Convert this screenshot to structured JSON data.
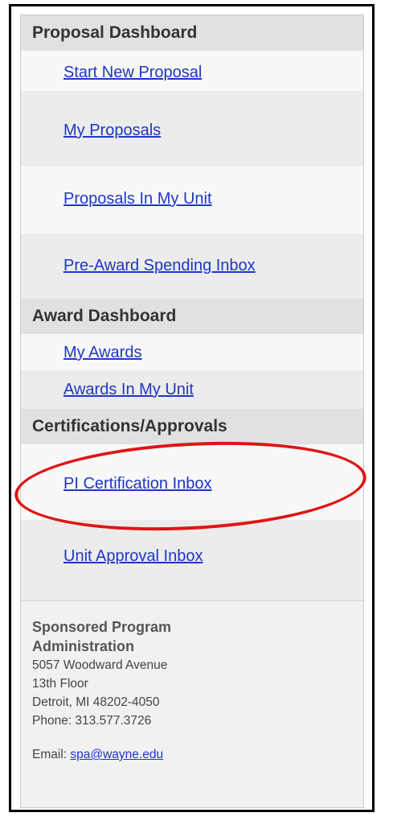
{
  "proposal_dashboard": {
    "heading": "Proposal Dashboard",
    "items": [
      {
        "label": "Start New Proposal"
      },
      {
        "label": "My Proposals"
      },
      {
        "label": "Proposals In My Unit"
      },
      {
        "label": "Pre-Award Spending Inbox"
      }
    ]
  },
  "award_dashboard": {
    "heading": "Award Dashboard",
    "items": [
      {
        "label": "My Awards"
      },
      {
        "label": "Awards In My Unit"
      }
    ]
  },
  "certifications": {
    "heading": "Certifications/Approvals",
    "items": [
      {
        "label": "PI Certification Inbox"
      },
      {
        "label": "Unit Approval Inbox"
      }
    ]
  },
  "contact": {
    "org_name": "Sponsored Program Administration",
    "address_line1": "5057 Woodward Avenue",
    "address_line2": "13th Floor",
    "city_line": "Detroit, MI 48202-4050",
    "phone": "Phone: 313.577.3726",
    "email_label": "Email:",
    "email": "spa@wayne.edu"
  },
  "annotation_color": "#e11414",
  "link_color": "#1f36c6"
}
